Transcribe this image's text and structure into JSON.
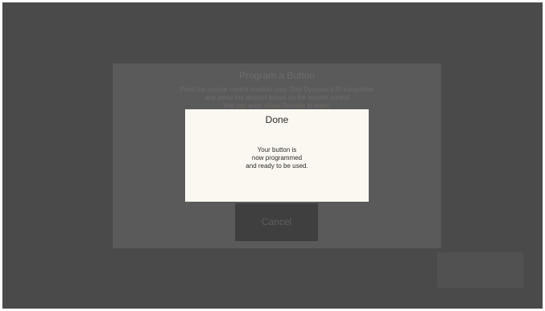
{
  "program_dialog": {
    "title": "Program a Button",
    "instructions": [
      "Point the remote control towards your Tobii Dynavox's IR transmitter",
      "and press the desired button on the remote control",
      "that you want virtual Remote to learn."
    ],
    "cancel_label": "Cancel"
  },
  "done_dialog": {
    "title": "Done",
    "message_lines": [
      "Your button is",
      "now programmed",
      "and ready to be used."
    ]
  }
}
